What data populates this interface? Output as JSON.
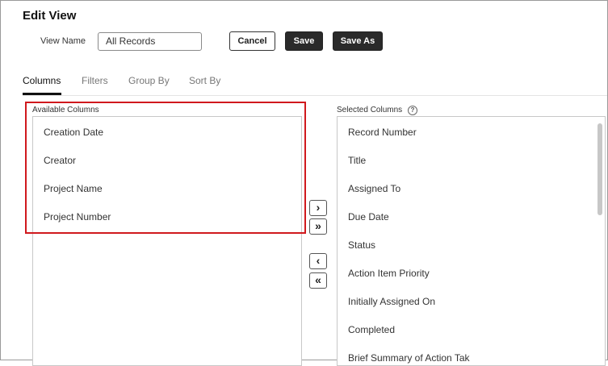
{
  "header": {
    "title": "Edit View",
    "view_name_label": "View Name",
    "view_name_value": "All Records",
    "cancel_label": "Cancel",
    "save_label": "Save",
    "save_as_label": "Save As"
  },
  "tabs": [
    {
      "label": "Columns",
      "active": true
    },
    {
      "label": "Filters",
      "active": false
    },
    {
      "label": "Group By",
      "active": false
    },
    {
      "label": "Sort By",
      "active": false
    }
  ],
  "available": {
    "label": "Available Columns",
    "items": [
      "Creation Date",
      "Creator",
      "Project Name",
      "Project Number"
    ]
  },
  "selected": {
    "label": "Selected Columns",
    "help_icon": "?",
    "items": [
      "Record Number",
      "Title",
      "Assigned To",
      "Due Date",
      "Status",
      "Action Item Priority",
      "Initially Assigned On",
      "Completed",
      "Brief Summary of Action Tak"
    ]
  },
  "move_buttons": {
    "move_right": "›",
    "move_all_right": "»",
    "move_left": "‹",
    "move_all_left": "«"
  }
}
